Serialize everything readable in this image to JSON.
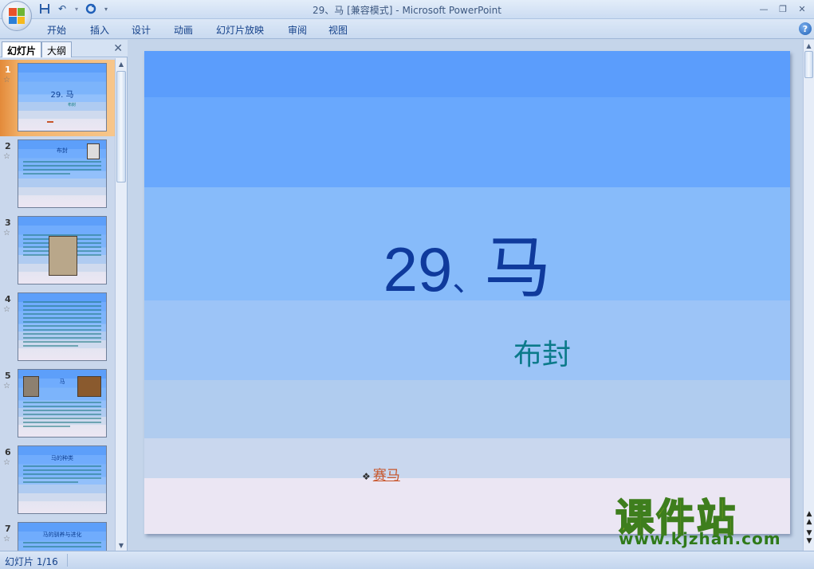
{
  "window": {
    "title": "29、马 [兼容模式] - Microsoft PowerPoint",
    "controls": [
      "minimize-icon",
      "restore-icon",
      "close-icon"
    ]
  },
  "ribbon": {
    "tabs": [
      "开始",
      "插入",
      "设计",
      "动画",
      "幻灯片放映",
      "审阅",
      "视图"
    ]
  },
  "left_pane": {
    "tabs": [
      "幻灯片",
      "大纲"
    ],
    "thumbnails": [
      {
        "num": "1",
        "title": "29. 马",
        "sub": "布封"
      },
      {
        "num": "2",
        "title": "布封",
        "sub": ""
      },
      {
        "num": "3",
        "title": "",
        "sub": ""
      },
      {
        "num": "4",
        "title": "",
        "sub": ""
      },
      {
        "num": "5",
        "title": "马",
        "sub": ""
      },
      {
        "num": "6",
        "title": "马的种类",
        "sub": ""
      },
      {
        "num": "7",
        "title": "马的驯养与进化",
        "sub": ""
      }
    ]
  },
  "slide": {
    "title_number": "29",
    "title_sep": "、",
    "title_char": "马",
    "author": "布封",
    "link_bullet": "❖",
    "link_text": "赛马",
    "bands": [
      "#5b9dfc",
      "#69a8fd",
      "#78b2fb",
      "#87bbfa",
      "#9cc4f7",
      "#b0ccef",
      "#c9d7ee",
      "#dde2f1",
      "#ebe6f3"
    ]
  },
  "watermark": {
    "cn": "课件站",
    "url": "www.kjzhan.com"
  },
  "status": {
    "slide_indicator": "幻灯片 1/16"
  }
}
